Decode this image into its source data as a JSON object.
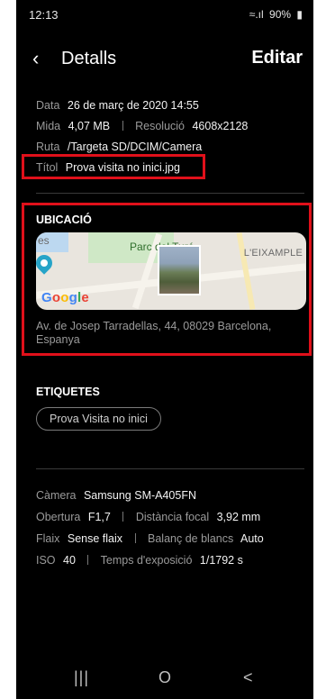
{
  "status_bar": {
    "time": "12:13",
    "battery": "90%",
    "signal": "≈.∥"
  },
  "header": {
    "back_icon": "‹",
    "title": "Detalls",
    "edit_label": "Editar"
  },
  "file_info": {
    "date_label": "Data",
    "date_value": "26 de març de 2020 14:55",
    "size_label": "Mida",
    "size_value": "4,07 MB",
    "resolution_label": "Resolució",
    "resolution_value": "4608x2128",
    "path_label": "Ruta",
    "path_value": "/Targeta SD/DCIM/Camera",
    "title_label": "Títol",
    "title_value": "Prova visita no inici.jpg"
  },
  "location": {
    "section_title": "UBICACIÓ",
    "map_label_es": "es",
    "map_label_parc": "Parc del Turó",
    "map_label_eixample": "L'EIXAMPLE",
    "map_brand": "Google",
    "address": "Av. de Josep Tarradellas, 44, 08029 Barcelona, Espanya"
  },
  "tags": {
    "section_title": "ETIQUETES",
    "items": [
      "Prova Visita no inici"
    ]
  },
  "camera_info": {
    "camera_label": "Càmera",
    "camera_value": "Samsung SM-A405FN",
    "aperture_label": "Obertura",
    "aperture_value": "F1,7",
    "focal_label": "Distància focal",
    "focal_value": "3,92 mm",
    "flash_label": "Flaix",
    "flash_value": "Sense flaix",
    "wb_label": "Balanç de blancs",
    "wb_value": "Auto",
    "iso_label": "ISO",
    "iso_value": "40",
    "exposure_label": "Temps d'exposició",
    "exposure_value": "1/1792 s"
  },
  "nav_bar": {
    "recents": "|||",
    "home": "O",
    "back": "<"
  },
  "colors": {
    "highlight": "#e0101a",
    "background": "#000000",
    "label_grey": "#9a9a9a"
  }
}
